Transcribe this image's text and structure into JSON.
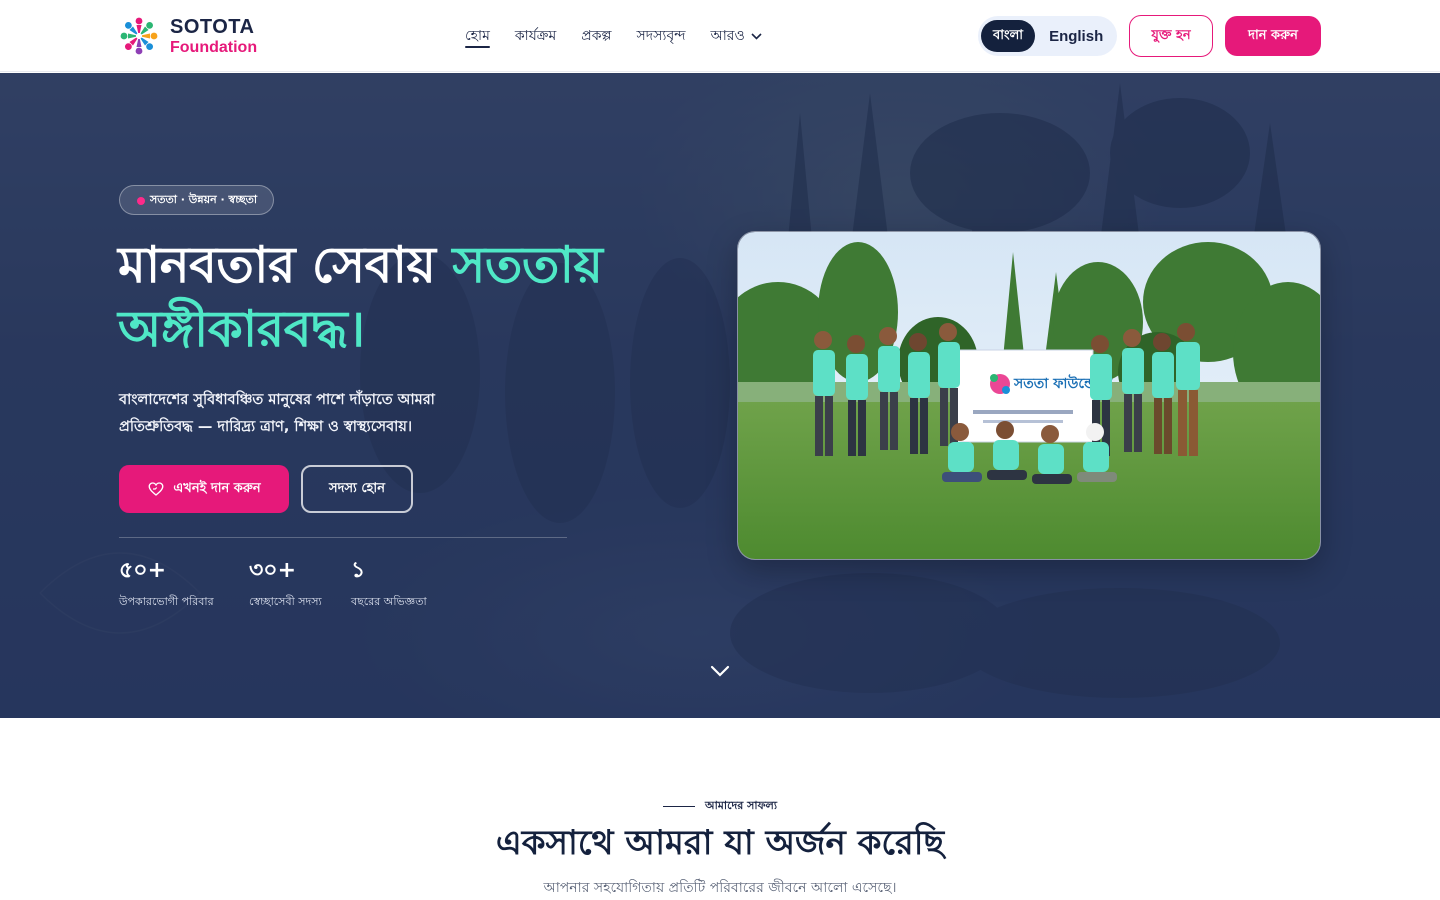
{
  "header": {
    "logo_title": "SOTOTA",
    "logo_subtitle": "Foundation",
    "nav": [
      {
        "label": "হোম"
      },
      {
        "label": "কার্যক্রম"
      },
      {
        "label": "প্রকল্প"
      },
      {
        "label": "সদস্যবৃন্দ"
      },
      {
        "label": "আরও"
      }
    ],
    "lang_bn": "বাংলা",
    "lang_en": "English",
    "join_label": "যুক্ত হন",
    "donate_label": "দান করুন"
  },
  "hero": {
    "tagline": "সততা · উন্নয়ন · স্বচ্ছতা",
    "headline_part1": "মানবতার সেবায়",
    "headline_highlight1": "সততায়",
    "headline_highlight2": "অঙ্গীকারবদ্ধ।",
    "description": "বাংলাদেশের সুবিধাবঞ্চিত মানুষের পাশে দাঁড়াতে আমরা প্রতিশ্রুতিবদ্ধ — দারিদ্র্য ত্রাণ, শিক্ষা ও স্বাস্থ্যসেবায়।",
    "donate_now_label": "এখনই দান করুন",
    "member_label": "সদস্য হোন",
    "stats": [
      {
        "value": "৫০+",
        "label": "উপকারভোগী পরিবার"
      },
      {
        "value": "৩০+",
        "label": "স্বেচ্ছাসেবী সদস্য"
      },
      {
        "value": "১",
        "label": "বছরের অভিজ্ঞতা"
      }
    ],
    "photo_banner_text": "সততা ফাউন্ডেশন"
  },
  "achievements": {
    "eyebrow": "আমাদের সাফল্য",
    "title": "একসাথে আমরা যা অর্জন করেছি",
    "subtitle": "আপনার সহযোগিতায় প্রতিটি পরিবারের জীবনে আলো এসেছে।"
  },
  "colors": {
    "brand_pink": "#e6197a",
    "brand_navy": "#14213d",
    "accent_teal": "#4fe8c6"
  },
  "icons": {
    "logo": "people-circle-logo",
    "dropdown": "chevron-down-icon",
    "donate": "heart-hand-icon",
    "scroll": "chevron-down-icon"
  }
}
